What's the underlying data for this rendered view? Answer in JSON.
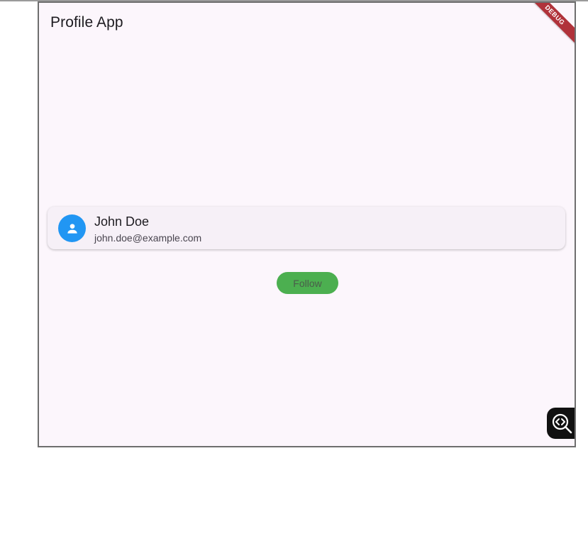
{
  "app": {
    "title": "Profile App",
    "debug_banner": "DEBUG"
  },
  "profile": {
    "name": "John Doe",
    "email": "john.doe@example.com",
    "avatar_icon": "person-icon",
    "avatar_color": "#2196f3"
  },
  "actions": {
    "follow_label": "Follow",
    "follow_color": "#4caf50"
  },
  "overlay": {
    "inspector_icon": "widget-inspector-icon"
  },
  "colors": {
    "background": "#fcf6fc",
    "card": "#f6f0f7",
    "banner": "#b0323a"
  }
}
